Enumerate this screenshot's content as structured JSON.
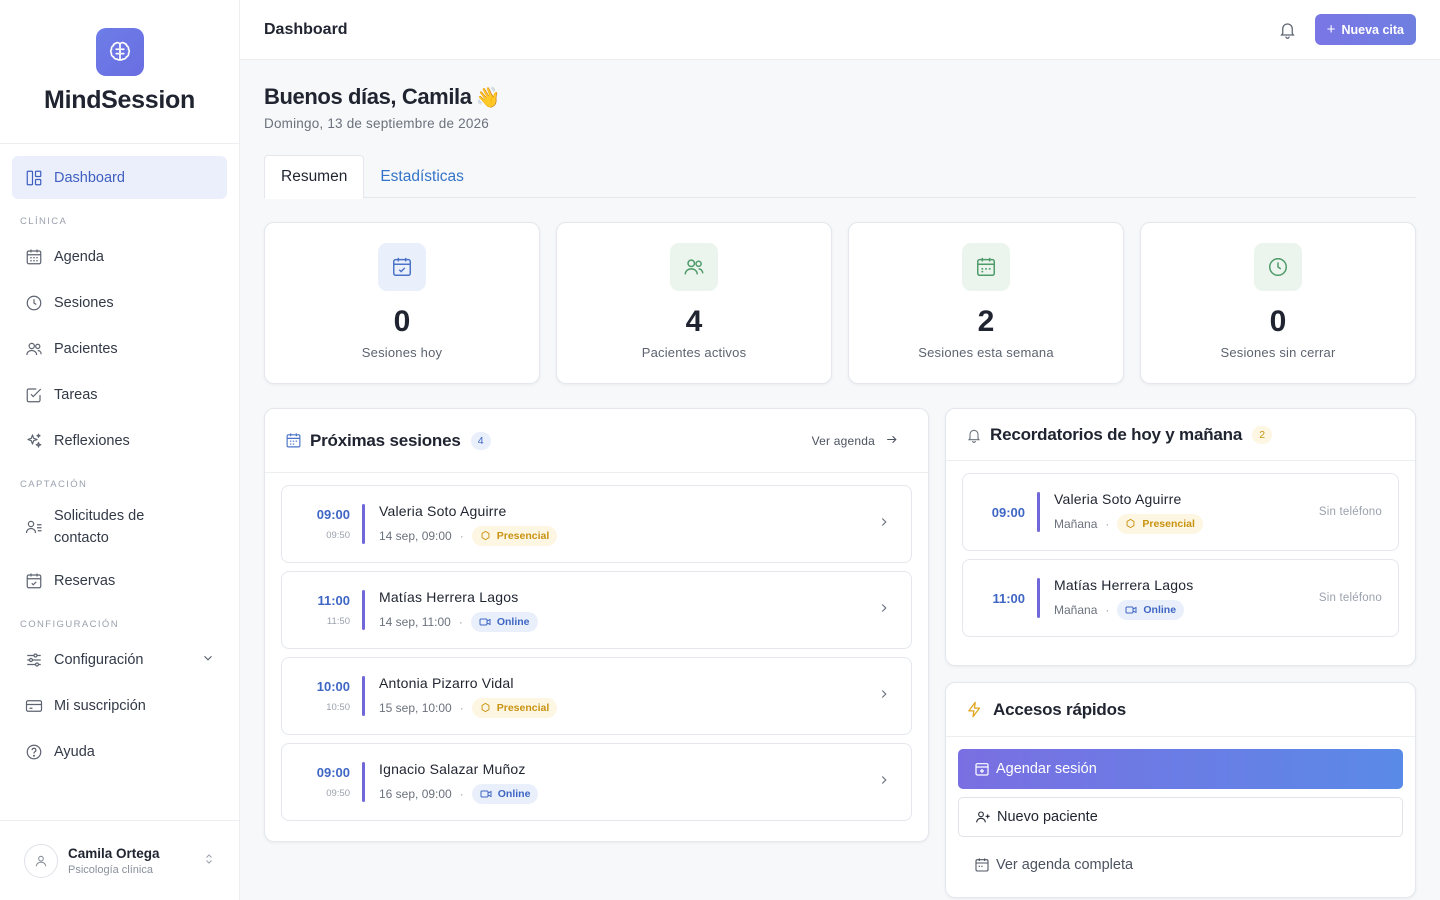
{
  "brand": {
    "name": "MindSession"
  },
  "sidebar": {
    "dashboard": "Dashboard",
    "section_clinica": "CLÍNICA",
    "agenda": "Agenda",
    "sesiones": "Sesiones",
    "pacientes": "Pacientes",
    "tareas": "Tareas",
    "reflexiones": "Reflexiones",
    "section_captacion": "CAPTACIÓN",
    "solicitudes_1": "Solicitudes de",
    "solicitudes_2": "contacto",
    "reservas": "Reservas",
    "section_config": "CONFIGURACIÓN",
    "configuracion": "Configuración",
    "suscripcion": "Mi suscripción",
    "ayuda": "Ayuda"
  },
  "user": {
    "name": "Camila Ortega",
    "role": "Psicología clínica"
  },
  "topbar": {
    "title": "Dashboard",
    "new_label": "Nueva cita"
  },
  "main": {
    "greeting": "Buenos días, Camila",
    "date": "Domingo, 13 de septiembre de 2026",
    "tabs": [
      "Resumen",
      "Estadísticas"
    ]
  },
  "stats": [
    {
      "value": "0",
      "label": "Sesiones hoy"
    },
    {
      "value": "4",
      "label": "Pacientes activos"
    },
    {
      "value": "2",
      "label": "Sesiones esta semana"
    },
    {
      "value": "0",
      "label": "Sesiones sin cerrar"
    }
  ],
  "upcoming": {
    "title": "Próximas sesiones",
    "count": "4",
    "link": "Ver agenda",
    "rows": [
      {
        "start": "09:00",
        "end": "09:50",
        "name": "Valeria Soto Aguirre",
        "when": "14 sep, 09:00",
        "mode": "Presencial"
      },
      {
        "start": "11:00",
        "end": "11:50",
        "name": "Matías Herrera Lagos",
        "when": "14 sep, 11:00",
        "mode": "Online"
      },
      {
        "start": "10:00",
        "end": "10:50",
        "name": "Antonia Pizarro Vidal",
        "when": "15 sep, 10:00",
        "mode": "Presencial"
      },
      {
        "start": "09:00",
        "end": "09:50",
        "name": "Ignacio Salazar Muñoz",
        "when": "16 sep, 09:00",
        "mode": "Online"
      }
    ]
  },
  "reminders": {
    "title": "Recordatorios de hoy y mañana",
    "count": "2",
    "rows": [
      {
        "time": "09:00",
        "name": "Valeria Soto Aguirre",
        "day": "Mañana",
        "mode": "Presencial",
        "phone": "Sin teléfono"
      },
      {
        "time": "11:00",
        "name": "Matías Herrera Lagos",
        "day": "Mañana",
        "mode": "Online",
        "phone": "Sin teléfono"
      }
    ]
  },
  "quick": {
    "title": "Accesos rápidos",
    "agendar": "Agendar sesión",
    "nuevo": "Nuevo paciente",
    "ver": "Ver agenda completa"
  },
  "colors": {
    "accent": "#6f74e0",
    "link": "#3474c8",
    "amber": "#c99312"
  }
}
